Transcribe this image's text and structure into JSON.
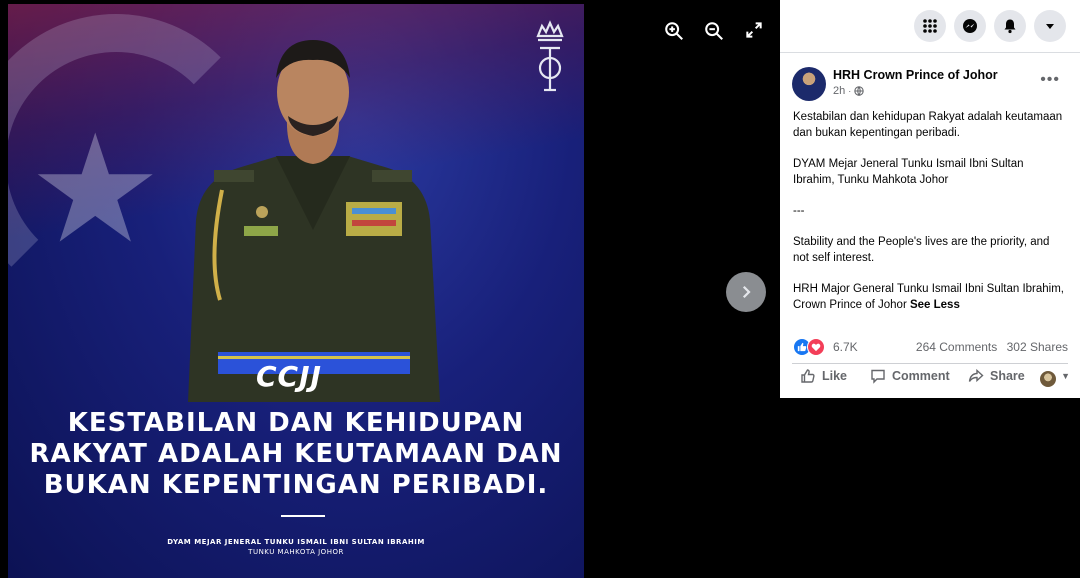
{
  "photo": {
    "caption_line1": "KESTABILAN DAN KEHIDUPAN",
    "caption_line2": "RAKYAT ADALAH KEUTAMAAN DAN",
    "caption_line3": "BUKAN KEPENTINGAN PERIBADI.",
    "credit_line1": "DYAM MEJAR JENERAL TUNKU ISMAIL IBNI SULTAN IBRAHIM",
    "credit_line2": "TUNKU MAHKOTA JOHOR",
    "belt_mark": "CCJJ"
  },
  "viewer_controls": {
    "zoom_in_icon": "zoom-in-icon",
    "zoom_out_icon": "zoom-out-icon",
    "fullscreen_icon": "fullscreen-icon",
    "next_icon": "chevron-right-icon"
  },
  "topbar": {
    "icons": [
      "menu-grid-icon",
      "messenger-icon",
      "notifications-bell-icon",
      "account-caret-icon"
    ]
  },
  "post": {
    "author": "HRH Crown Prince of Johor",
    "time": "2h",
    "privacy_icon": "globe-icon",
    "more_label": "•••",
    "paragraphs": [
      "Kestabilan dan kehidupan Rakyat adalah keutamaan dan bukan kepentingan peribadi.",
      "DYAM Mejar Jeneral Tunku Ismail Ibni Sultan Ibrahim, Tunku Mahkota Johor",
      "---",
      "Stability and the People's lives are the priority, and not self interest."
    ],
    "last_paragraph": "HRH Major General Tunku Ismail Ibni Sultan Ibrahim, Crown Prince of Johor",
    "see_less": "See Less",
    "reaction_count": "6.7K",
    "comments": "264 Comments",
    "shares": "302 Shares",
    "actions": {
      "like": "Like",
      "comment": "Comment",
      "share": "Share"
    }
  },
  "colors": {
    "accent": "#1877f2",
    "love": "#f33e58",
    "muted_text": "#65676b",
    "photo_bg": "#18207a"
  }
}
